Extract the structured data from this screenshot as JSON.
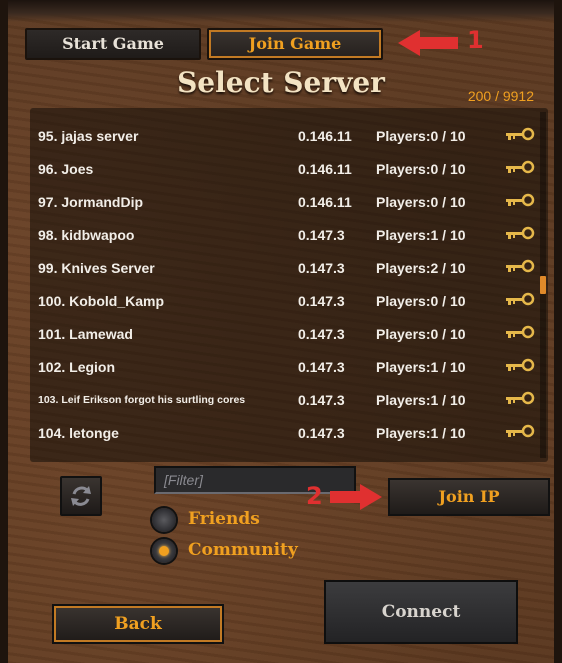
{
  "tabs": [
    {
      "label": "Start Game",
      "active": false
    },
    {
      "label": "Join Game",
      "active": true
    }
  ],
  "annotations": [
    {
      "number": "1",
      "color": "#e03030"
    },
    {
      "number": "2",
      "color": "#e03030"
    }
  ],
  "title": "Select Server",
  "server_count": "200 / 9912",
  "servers": [
    {
      "name": "95. jajas server",
      "version": "0.146.11",
      "players": "Players:0 / 10",
      "icon": "key-icon"
    },
    {
      "name": "96. Joes",
      "version": "0.146.11",
      "players": "Players:0 / 10",
      "icon": "key-icon"
    },
    {
      "name": "97. JormandDip",
      "version": "0.146.11",
      "players": "Players:0 / 10",
      "icon": "key-icon"
    },
    {
      "name": "98. kidbwapoo",
      "version": "0.147.3",
      "players": "Players:1 / 10",
      "icon": "key-icon"
    },
    {
      "name": "99. Knives Server",
      "version": "0.147.3",
      "players": "Players:2 / 10",
      "icon": "key-icon"
    },
    {
      "name": "100. Kobold_Kamp",
      "version": "0.147.3",
      "players": "Players:0 / 10",
      "icon": "key-icon"
    },
    {
      "name": "101. Lamewad",
      "version": "0.147.3",
      "players": "Players:0 / 10",
      "icon": "key-icon"
    },
    {
      "name": "102. Legion",
      "version": "0.147.3",
      "players": "Players:1 / 10",
      "icon": "key-icon"
    },
    {
      "name": "103. Leif Erikson forgot his surtling cores",
      "version": "0.147.3",
      "players": "Players:1 / 10",
      "icon": "key-icon"
    },
    {
      "name": "104. letonge",
      "version": "0.147.3",
      "players": "Players:1 / 10",
      "icon": "key-icon"
    }
  ],
  "filter": {
    "placeholder": "[Filter]"
  },
  "join_ip_label": "Join IP",
  "radio_options": [
    {
      "label": "Friends",
      "selected": false
    },
    {
      "label": "Community",
      "selected": true
    }
  ],
  "back_label": "Back",
  "connect_label": "Connect",
  "colors": {
    "accent": "#f0a020",
    "annotation": "#e03030",
    "wood": "#5d3a22"
  }
}
